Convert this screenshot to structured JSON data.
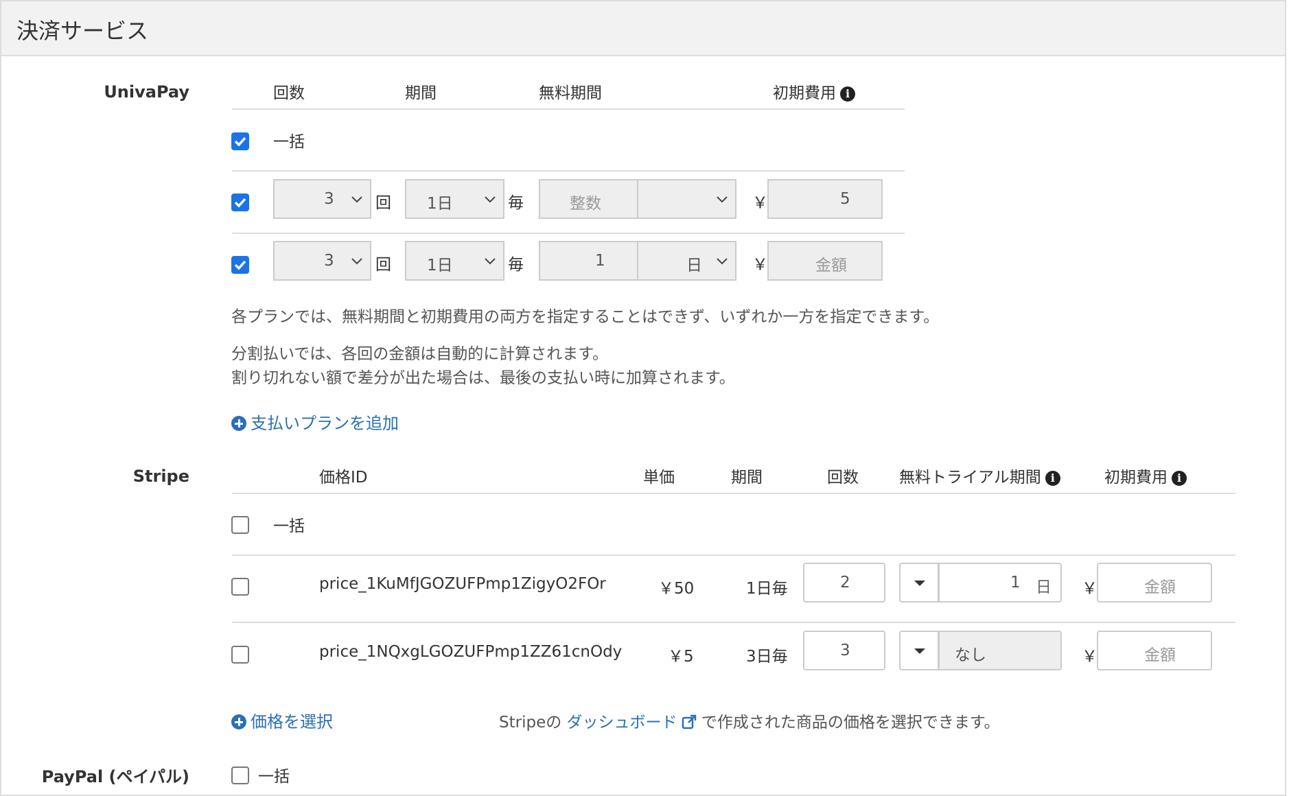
{
  "panel": {
    "title": "決済サービス"
  },
  "univapay": {
    "label": "UnivaPay",
    "headers": {
      "count": "回数",
      "period": "期間",
      "free_period": "無料期間",
      "initial_fee": "初期費用"
    },
    "lump": {
      "label": "一括",
      "checked": true
    },
    "rows": [
      {
        "checked": true,
        "count": "3",
        "count_unit": "回",
        "period": "1日",
        "period_unit": "毎",
        "free_value": "整数",
        "free_value_is_placeholder": true,
        "free_unit": "",
        "currency": "￥",
        "fee": "5",
        "fee_is_placeholder": false
      },
      {
        "checked": true,
        "count": "3",
        "count_unit": "回",
        "period": "1日",
        "period_unit": "毎",
        "free_value": "1",
        "free_value_is_placeholder": false,
        "free_unit": "日",
        "currency": "￥",
        "fee": "金額",
        "fee_is_placeholder": true
      }
    ],
    "note1": "各プランでは、無料期間と初期費用の両方を指定することはできず、いずれか一方を指定できます。",
    "note2": "分割払いでは、各回の金額は自動的に計算されます。",
    "note3": "割り切れない額で差分が出た場合は、最後の支払い時に加算されます。",
    "add_plan": "支払いプランを追加"
  },
  "stripe": {
    "label": "Stripe",
    "headers": {
      "price_id": "価格ID",
      "unit_price": "単価",
      "period": "期間",
      "count": "回数",
      "free_trial": "無料トライアル期間",
      "initial_fee": "初期費用"
    },
    "lump": {
      "label": "一括",
      "checked": false
    },
    "rows": [
      {
        "checked": false,
        "price_id": "price_1KuMfJGOZUFPmp1ZigyO2FOr",
        "unit_price": "￥50",
        "period": "1日毎",
        "count": "2",
        "trial_value": "1",
        "trial_unit": "日",
        "trial_disabled": false,
        "currency": "￥",
        "fee": "金額"
      },
      {
        "checked": false,
        "price_id": "price_1NQxgLGOZUFPmp1ZZ61cnOdy",
        "unit_price": "￥5",
        "period": "3日毎",
        "count": "3",
        "trial_value": "なし",
        "trial_unit": "",
        "trial_disabled": true,
        "currency": "￥",
        "fee": "金額"
      }
    ],
    "select_price": "価格を選択",
    "hint_prefix": "Stripeの",
    "hint_link": "ダッシュボード",
    "hint_suffix": "で作成された商品の価格を選択できます。"
  },
  "paypal": {
    "label": "PayPal (ペイパル)",
    "lump": {
      "label": "一括",
      "checked": false
    }
  },
  "colors": {
    "accent": "#1a73e8",
    "link": "#2a6fb8"
  }
}
